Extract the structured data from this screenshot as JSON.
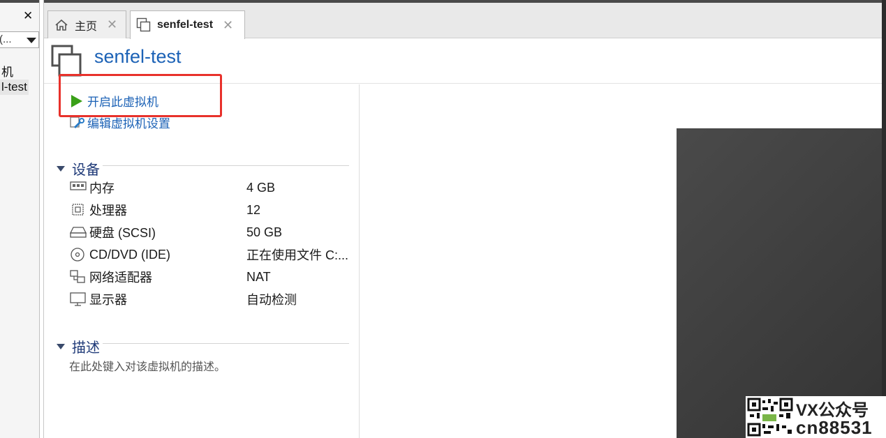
{
  "library": {
    "search_placeholder": "(...",
    "tree": [
      {
        "label": "机",
        "selected": false
      },
      {
        "label": "l-test",
        "selected": true
      }
    ]
  },
  "tabs": [
    {
      "label": "主页",
      "icon": "home-icon",
      "active": false
    },
    {
      "label": "senfel-test",
      "icon": "vm-icon",
      "active": true
    }
  ],
  "vm": {
    "title": "senfel-test"
  },
  "actions": {
    "power_on": "开启此虚拟机",
    "edit_settings": "编辑虚拟机设置"
  },
  "devices": {
    "heading": "设备",
    "items": [
      {
        "name": "内存",
        "value": "4 GB",
        "icon": "memory-icon"
      },
      {
        "name": "处理器",
        "value": "12",
        "icon": "cpu-icon"
      },
      {
        "name": "硬盘 (SCSI)",
        "value": "50 GB",
        "icon": "hard-disk-icon"
      },
      {
        "name": "CD/DVD (IDE)",
        "value": "正在使用文件 C:...",
        "icon": "cd-dvd-icon"
      },
      {
        "name": "网络适配器",
        "value": "NAT",
        "icon": "network-adapter-icon"
      },
      {
        "name": "显示器",
        "value": "自动检测",
        "icon": "display-icon"
      }
    ]
  },
  "description": {
    "heading": "描述",
    "placeholder": "在此处键入对该虚拟机的描述。"
  },
  "watermark": {
    "line1": "VX公众号",
    "line2": "cn88531"
  },
  "colors": {
    "link": "#1c62b6",
    "section": "#1f3a78",
    "highlight": "#e8312b",
    "play": "#3aa018",
    "preview": "#3f3f3f"
  }
}
